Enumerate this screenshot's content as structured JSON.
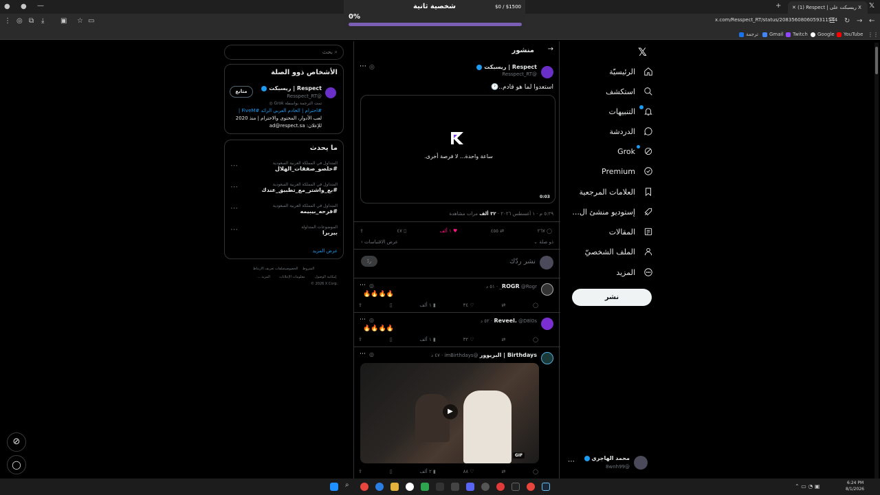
{
  "browser": {
    "tab_title": "(1) Respect | ريسبكت على X",
    "url": "x.com/Resspect_RT/status/2083560806059311544",
    "bookmarks": [
      "YouTube",
      "Google",
      "Twitch",
      "Gmail",
      "ترجمة"
    ]
  },
  "overlay": {
    "title": "شخصية ثانية",
    "money": "$0 / $1500",
    "percent": "0%",
    "progress": 0
  },
  "nav": {
    "items": [
      {
        "label": "الرئيسيّة",
        "icon": "home-icon"
      },
      {
        "label": "استكشف",
        "icon": "search-icon"
      },
      {
        "label": "التنبيهات",
        "icon": "bell-icon"
      },
      {
        "label": "الدردشة",
        "icon": "chat-icon"
      },
      {
        "label": "Grok",
        "icon": "grok-icon"
      },
      {
        "label": "Premium",
        "icon": "premium-icon"
      },
      {
        "label": "العلامات المرجعية",
        "icon": "bookmark-icon"
      },
      {
        "label": "إستوديو منشئ ال...",
        "icon": "rocket-icon"
      },
      {
        "label": "المقالات",
        "icon": "article-icon"
      },
      {
        "label": "الملف الشخصيّ",
        "icon": "person-icon"
      },
      {
        "label": "المزيد",
        "icon": "more-icon"
      }
    ],
    "post_button": "نشر",
    "account": {
      "name": "محمد الهاجري",
      "handle": "@8wnh99"
    }
  },
  "main": {
    "header": "منشور",
    "post": {
      "name": "Respect | ريسبكت",
      "handle": "@Resspect_RT",
      "text": "استعدوا لما هو قادم..🕐",
      "video_caption": "ساعة واحدة... لا فرصة أخرى.",
      "video_time": "0:03",
      "meta_time": "٥:٢٩ م · ١ أغسطس ٢٠٢٦ ·",
      "views": "٣٢ ألف",
      "views_label": "مرات مشاهدة",
      "replies": "٢٦٧",
      "reposts": "٤٥٥",
      "likes": "١ ألف",
      "bookmarks": "٤٧",
      "related": "ذو صلة",
      "quotes": "عرض الاقتباسات"
    },
    "reply_placeholder": "نشر ردّك",
    "reply_button": "ردّ",
    "replies": [
      {
        "name": "ROGR",
        "handle": "@Rogr_",
        "time": "· ٥١ د",
        "text": "🔥🔥🔥🔥",
        "likes": "٣٤",
        "views": "١ ألف"
      },
      {
        "name": "Reveel.",
        "handle": "@D8l0s",
        "time": "· ٥٢ د",
        "text": "🔥🔥🔥🔥",
        "likes": "٣٢",
        "views": "١ ألف"
      },
      {
        "name": "Birthdays | البريوور",
        "handle": "@imBirthdays",
        "time": "· ٤٧ د",
        "likes": "٨٨",
        "views": "٢ ألف",
        "gif": "GIF"
      }
    ]
  },
  "sidebar": {
    "search_placeholder": "بحث",
    "related_title": "الأشخاص ذوو الصلة",
    "related": {
      "name": "Respect | ريسبكت",
      "handle": "@Resspect_RT",
      "follow": "متابع",
      "translated": "تمت الترجمة بواسطة Grok",
      "bio_hashtags": "#احترام | الخادم العربي الرائد #FiveM |",
      "bio_line2": "لعب الأدوار، المحتوى والاحترام | منذ 2020",
      "bio_line3": "للإعلان: ad@respect.sa"
    },
    "trends_title": "ما يحدث",
    "trends": [
      {
        "meta": "المتداول في المملكة العربية السعودية",
        "tag": "#خلصو_صفقات_الهلال"
      },
      {
        "meta": "المتداول في المملكة العربية السعودية",
        "tag": "#بع_واشتر_مع_تطبيق_عندك"
      },
      {
        "meta": "المتداول في المملكة العربية السعودية",
        "tag": "#فرحه_بيبيمه"
      },
      {
        "meta": "الموضوعات المتداولة",
        "tag": "بيربرا"
      }
    ],
    "show_more": "عرض المزيد",
    "footer": [
      "الشروط",
      "الخصوصية",
      "ملفات تعريف الارتباط",
      "إمكانية الوصول",
      "معلومات الإعلانات",
      "المزيد ...",
      "© 2026 X Corp."
    ]
  },
  "taskbar": {
    "time": "6:24 PM",
    "date": "8/1/2026"
  },
  "colors": {
    "accent": "#1d9bf0",
    "like": "#f91880",
    "progress": "#7b5fb5"
  }
}
